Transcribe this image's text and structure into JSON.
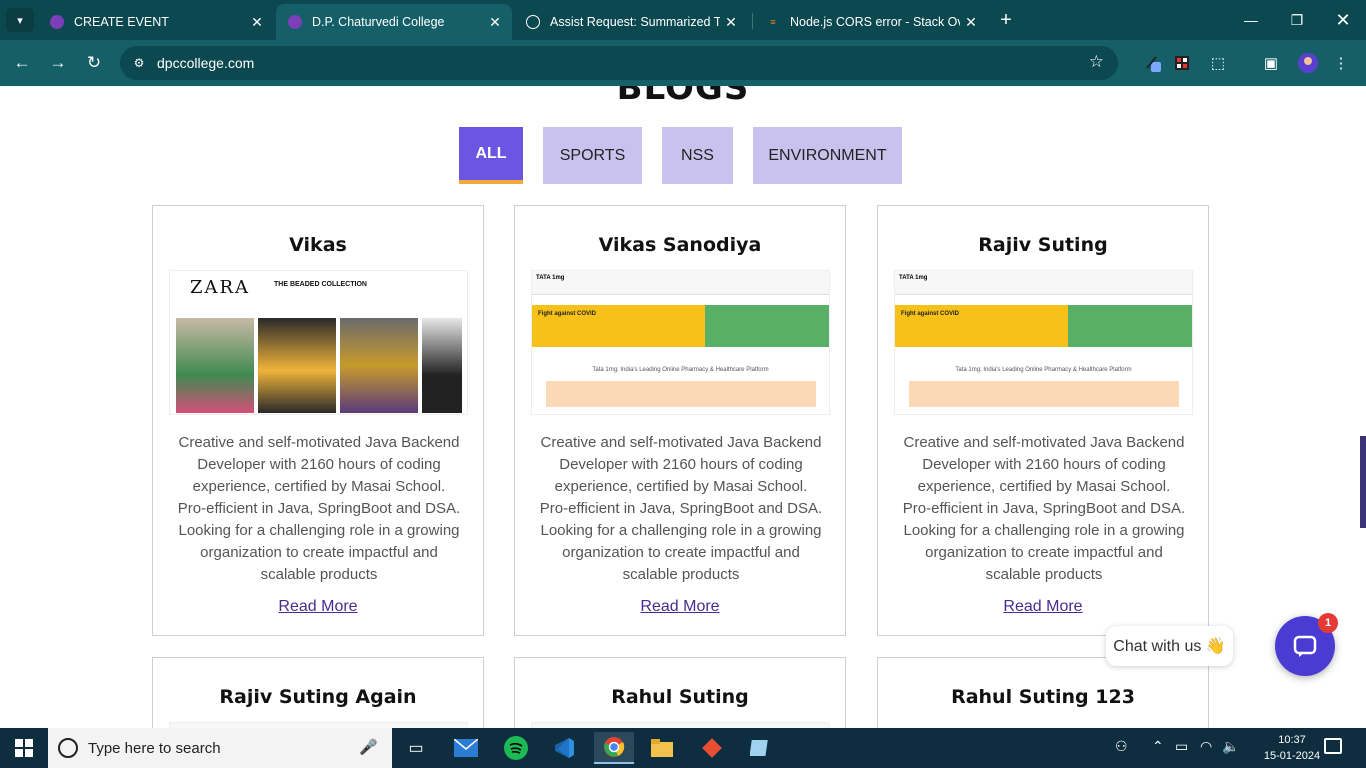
{
  "browser": {
    "tabs": [
      {
        "title": "CREATE EVENT"
      },
      {
        "title": "D.P. Chaturvedi College"
      },
      {
        "title": "Assist Request: Summarized Title"
      },
      {
        "title": "Node.js CORS error - Stack Overflow"
      }
    ],
    "url": "dpccollege.com"
  },
  "page": {
    "heading": "BLOGS",
    "filters": [
      "ALL",
      "SPORTS",
      "NSS",
      "ENVIRONMENT"
    ],
    "active_filter": "ALL",
    "cards": [
      {
        "title": "Vikas",
        "description": "Creative and self-motivated Java Backend Developer with 2160 hours of coding experience, certified by Masai School. Pro-efficient in Java, SpringBoot and DSA. Looking for a challenging role in a growing organization to create impactful and scalable products",
        "link": "Read More"
      },
      {
        "title": "Vikas Sanodiya",
        "description": "Creative and self-motivated Java Backend Developer with 2160 hours of coding experience, certified by Masai School. Pro-efficient in Java, SpringBoot and DSA. Looking for a challenging role in a growing organization to create impactful and scalable products",
        "link": "Read More"
      },
      {
        "title": "Rajiv Suting",
        "description": "Creative and self-motivated Java Backend Developer with 2160 hours of coding experience, certified by Masai School. Pro-efficient in Java, SpringBoot and DSA. Looking for a challenging role in a growing organization to create impactful and scalable products",
        "link": "Read More"
      },
      {
        "title": "Rajiv Suting Again"
      },
      {
        "title": "Rahul Suting"
      },
      {
        "title": "Rahul Suting 123"
      }
    ],
    "thumbs": {
      "zara_logo": "ZARA",
      "zara_heading": "THE BEADED COLLECTION",
      "tata_brand": "TATA 1mg",
      "tata_banner": "Fight against COVID",
      "tata_tagline": "Tata 1mg: India's Leading Online Pharmacy & Healthcare Platform"
    }
  },
  "chat": {
    "label": "Chat with us 👋",
    "badge": "1"
  },
  "taskbar": {
    "search_placeholder": "Type here to search",
    "time": "10:37",
    "date": "15-01-2024"
  },
  "colors": {
    "accent": "#6c55e0",
    "filter_bg": "#c9c2ee",
    "active_underline": "#f2a93b",
    "chrome": "#145f68"
  }
}
